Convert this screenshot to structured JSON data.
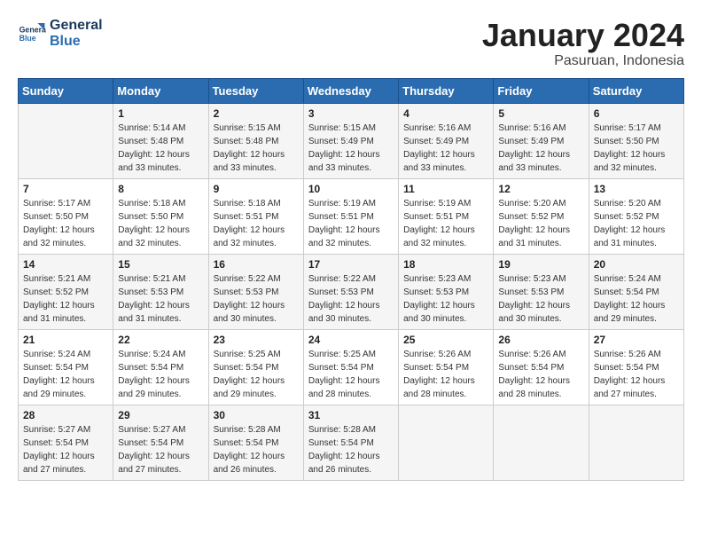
{
  "header": {
    "logo_general": "General",
    "logo_blue": "Blue",
    "month_title": "January 2024",
    "subtitle": "Pasuruan, Indonesia"
  },
  "days_header": [
    "Sunday",
    "Monday",
    "Tuesday",
    "Wednesday",
    "Thursday",
    "Friday",
    "Saturday"
  ],
  "weeks": [
    [
      {
        "day": "",
        "info": ""
      },
      {
        "day": "1",
        "info": "Sunrise: 5:14 AM\nSunset: 5:48 PM\nDaylight: 12 hours\nand 33 minutes."
      },
      {
        "day": "2",
        "info": "Sunrise: 5:15 AM\nSunset: 5:48 PM\nDaylight: 12 hours\nand 33 minutes."
      },
      {
        "day": "3",
        "info": "Sunrise: 5:15 AM\nSunset: 5:49 PM\nDaylight: 12 hours\nand 33 minutes."
      },
      {
        "day": "4",
        "info": "Sunrise: 5:16 AM\nSunset: 5:49 PM\nDaylight: 12 hours\nand 33 minutes."
      },
      {
        "day": "5",
        "info": "Sunrise: 5:16 AM\nSunset: 5:49 PM\nDaylight: 12 hours\nand 33 minutes."
      },
      {
        "day": "6",
        "info": "Sunrise: 5:17 AM\nSunset: 5:50 PM\nDaylight: 12 hours\nand 32 minutes."
      }
    ],
    [
      {
        "day": "7",
        "info": "Sunrise: 5:17 AM\nSunset: 5:50 PM\nDaylight: 12 hours\nand 32 minutes."
      },
      {
        "day": "8",
        "info": "Sunrise: 5:18 AM\nSunset: 5:50 PM\nDaylight: 12 hours\nand 32 minutes."
      },
      {
        "day": "9",
        "info": "Sunrise: 5:18 AM\nSunset: 5:51 PM\nDaylight: 12 hours\nand 32 minutes."
      },
      {
        "day": "10",
        "info": "Sunrise: 5:19 AM\nSunset: 5:51 PM\nDaylight: 12 hours\nand 32 minutes."
      },
      {
        "day": "11",
        "info": "Sunrise: 5:19 AM\nSunset: 5:51 PM\nDaylight: 12 hours\nand 32 minutes."
      },
      {
        "day": "12",
        "info": "Sunrise: 5:20 AM\nSunset: 5:52 PM\nDaylight: 12 hours\nand 31 minutes."
      },
      {
        "day": "13",
        "info": "Sunrise: 5:20 AM\nSunset: 5:52 PM\nDaylight: 12 hours\nand 31 minutes."
      }
    ],
    [
      {
        "day": "14",
        "info": "Sunrise: 5:21 AM\nSunset: 5:52 PM\nDaylight: 12 hours\nand 31 minutes."
      },
      {
        "day": "15",
        "info": "Sunrise: 5:21 AM\nSunset: 5:53 PM\nDaylight: 12 hours\nand 31 minutes."
      },
      {
        "day": "16",
        "info": "Sunrise: 5:22 AM\nSunset: 5:53 PM\nDaylight: 12 hours\nand 30 minutes."
      },
      {
        "day": "17",
        "info": "Sunrise: 5:22 AM\nSunset: 5:53 PM\nDaylight: 12 hours\nand 30 minutes."
      },
      {
        "day": "18",
        "info": "Sunrise: 5:23 AM\nSunset: 5:53 PM\nDaylight: 12 hours\nand 30 minutes."
      },
      {
        "day": "19",
        "info": "Sunrise: 5:23 AM\nSunset: 5:53 PM\nDaylight: 12 hours\nand 30 minutes."
      },
      {
        "day": "20",
        "info": "Sunrise: 5:24 AM\nSunset: 5:54 PM\nDaylight: 12 hours\nand 29 minutes."
      }
    ],
    [
      {
        "day": "21",
        "info": "Sunrise: 5:24 AM\nSunset: 5:54 PM\nDaylight: 12 hours\nand 29 minutes."
      },
      {
        "day": "22",
        "info": "Sunrise: 5:24 AM\nSunset: 5:54 PM\nDaylight: 12 hours\nand 29 minutes."
      },
      {
        "day": "23",
        "info": "Sunrise: 5:25 AM\nSunset: 5:54 PM\nDaylight: 12 hours\nand 29 minutes."
      },
      {
        "day": "24",
        "info": "Sunrise: 5:25 AM\nSunset: 5:54 PM\nDaylight: 12 hours\nand 28 minutes."
      },
      {
        "day": "25",
        "info": "Sunrise: 5:26 AM\nSunset: 5:54 PM\nDaylight: 12 hours\nand 28 minutes."
      },
      {
        "day": "26",
        "info": "Sunrise: 5:26 AM\nSunset: 5:54 PM\nDaylight: 12 hours\nand 28 minutes."
      },
      {
        "day": "27",
        "info": "Sunrise: 5:26 AM\nSunset: 5:54 PM\nDaylight: 12 hours\nand 27 minutes."
      }
    ],
    [
      {
        "day": "28",
        "info": "Sunrise: 5:27 AM\nSunset: 5:54 PM\nDaylight: 12 hours\nand 27 minutes."
      },
      {
        "day": "29",
        "info": "Sunrise: 5:27 AM\nSunset: 5:54 PM\nDaylight: 12 hours\nand 27 minutes."
      },
      {
        "day": "30",
        "info": "Sunrise: 5:28 AM\nSunset: 5:54 PM\nDaylight: 12 hours\nand 26 minutes."
      },
      {
        "day": "31",
        "info": "Sunrise: 5:28 AM\nSunset: 5:54 PM\nDaylight: 12 hours\nand 26 minutes."
      },
      {
        "day": "",
        "info": ""
      },
      {
        "day": "",
        "info": ""
      },
      {
        "day": "",
        "info": ""
      }
    ]
  ]
}
